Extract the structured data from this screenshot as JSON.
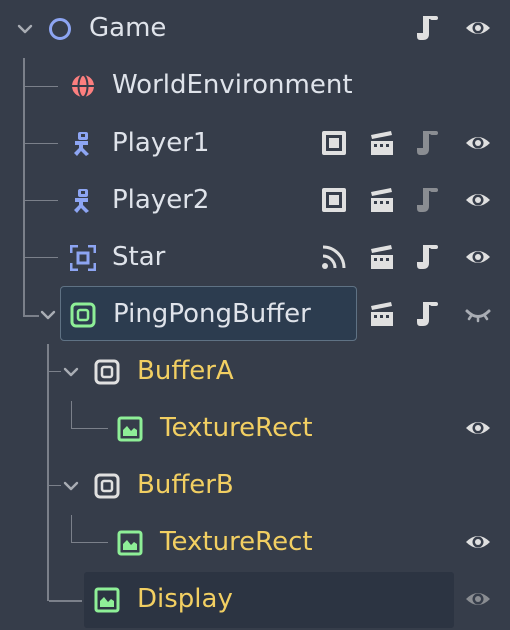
{
  "tree": {
    "nodes": [
      {
        "label": "Game",
        "type": "node2d-icon",
        "indicators": [
          "script-icon",
          "visibility-eye-icon"
        ]
      },
      {
        "label": "WorldEnvironment",
        "type": "world-environment-icon",
        "indicators": []
      },
      {
        "label": "Player1",
        "type": "character-body-icon",
        "indicators": [
          "group-icon",
          "instance-icon",
          "script-icon",
          "visibility-eye-icon"
        ]
      },
      {
        "label": "Player2",
        "type": "character-body-icon",
        "indicators": [
          "group-icon",
          "instance-icon",
          "script-icon",
          "visibility-eye-icon"
        ]
      },
      {
        "label": "Star",
        "type": "area-icon",
        "indicators": [
          "signal-icon",
          "instance-icon",
          "script-icon",
          "visibility-eye-icon"
        ]
      },
      {
        "label": "PingPongBuffer",
        "type": "subviewport-container-icon",
        "indicators": [
          "instance-icon",
          "script-icon",
          "visibility-closed-icon"
        ],
        "selected": true
      },
      {
        "label": "BufferA",
        "type": "subviewport-icon",
        "indicators": []
      },
      {
        "label": "TextureRect",
        "type": "texture-rect-icon",
        "indicators": [
          "visibility-eye-icon"
        ]
      },
      {
        "label": "BufferB",
        "type": "subviewport-icon",
        "indicators": []
      },
      {
        "label": "TextureRect",
        "type": "texture-rect-icon",
        "indicators": [
          "visibility-eye-icon"
        ]
      },
      {
        "label": "Display",
        "type": "texture-rect-icon",
        "indicators": [
          "visibility-eye-icon"
        ],
        "hovered": true
      }
    ]
  },
  "colors": {
    "background": "#363d4a",
    "selected_background": "#2c3c4f",
    "text": "#dfe3ea",
    "inherited_text": "#f2cf62",
    "node2d_blue": "#8da5f3",
    "control_green": "#8eef97",
    "environment_red": "#fc7f7f",
    "icon_gray": "#e0e0e0",
    "icon_disabled": "#8a8d92"
  }
}
